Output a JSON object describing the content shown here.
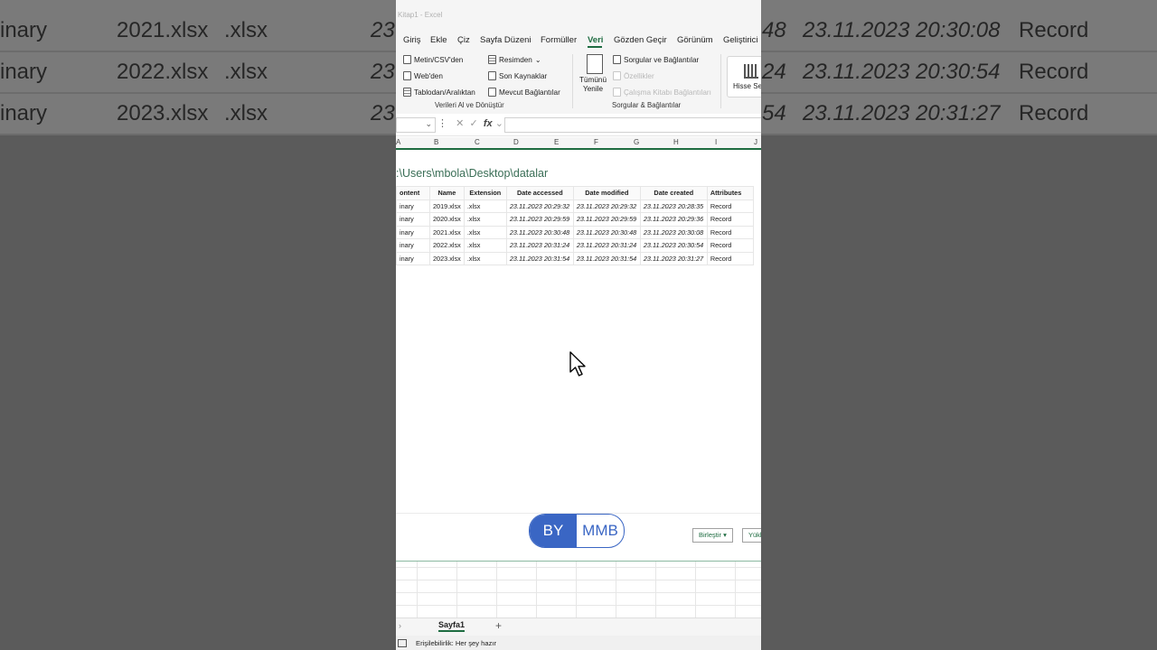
{
  "background": {
    "rows": [
      {
        "content": "inary",
        "name": "2021.xlsx",
        "ext": ".xlsx",
        "col_d": "23",
        "col_g_tail": "48",
        "date_created": "23.11.2023 20:30:08",
        "attr": "Record"
      },
      {
        "content": "inary",
        "name": "2022.xlsx",
        "ext": ".xlsx",
        "col_d": "23",
        "col_g_tail": "24",
        "date_created": "23.11.2023 20:30:54",
        "attr": "Record"
      },
      {
        "content": "inary",
        "name": "2023.xlsx",
        "ext": ".xlsx",
        "col_d": "23",
        "col_g_tail": "54",
        "date_created": "23.11.2023 20:31:27",
        "attr": "Record"
      }
    ]
  },
  "titlebar": {
    "text": "Kitap1  -  Excel"
  },
  "menu": {
    "items": [
      "Giriş",
      "Ekle",
      "Çiz",
      "Sayfa Düzeni",
      "Formüller",
      "Veri",
      "Gözden Geçir",
      "Görünüm",
      "Geliştirici"
    ],
    "active": "Veri"
  },
  "ribbon": {
    "get_data": {
      "from_csv": "Metin/CSV'den",
      "from_web": "Web'den",
      "from_table": "Tablodan/Aralıktan",
      "from_picture": "Resimden",
      "recent_sources": "Son Kaynaklar",
      "existing_connections": "Mevcut Bağlantılar",
      "group_label": "Verileri Al ve Dönüştür"
    },
    "queries": {
      "refresh_all_line1": "Tümünü",
      "refresh_all_line2": "Yenile",
      "queries_connections": "Sorgular ve Bağlantılar",
      "properties": "Özellikler",
      "workbook_links": "Çalışma Kitabı Bağlantıları",
      "group_label": "Sorgular & Bağlantılar"
    },
    "stocks": {
      "label": "Hisse Senedi"
    }
  },
  "formula_bar": {
    "fx": "fx",
    "value": ""
  },
  "columns": [
    "A",
    "B",
    "C",
    "D",
    "E",
    "F",
    "G",
    "H",
    "I",
    "J"
  ],
  "path": ":\\Users\\mbola\\Desktop\\datalar",
  "table": {
    "headers": [
      "ontent",
      "Name",
      "Extension",
      "Date accessed",
      "Date modified",
      "Date created",
      "Attributes"
    ],
    "rows": [
      [
        "inary",
        "2019.xlsx",
        ".xlsx",
        "23.11.2023 20:29:32",
        "23.11.2023 20:29:32",
        "23.11.2023 20:28:35",
        "Record"
      ],
      [
        "inary",
        "2020.xlsx",
        ".xlsx",
        "23.11.2023 20:29:59",
        "23.11.2023 20:29:59",
        "23.11.2023 20:29:36",
        "Record"
      ],
      [
        "inary",
        "2021.xlsx",
        ".xlsx",
        "23.11.2023 20:30:48",
        "23.11.2023 20:30:48",
        "23.11.2023 20:30:08",
        "Record"
      ],
      [
        "inary",
        "2022.xlsx",
        ".xlsx",
        "23.11.2023 20:31:24",
        "23.11.2023 20:31:24",
        "23.11.2023 20:30:54",
        "Record"
      ],
      [
        "inary",
        "2023.xlsx",
        ".xlsx",
        "23.11.2023 20:31:54",
        "23.11.2023 20:31:54",
        "23.11.2023 20:31:27",
        "Record"
      ]
    ]
  },
  "query_bar": {
    "combine": "Birleştir",
    "load": "Yükle"
  },
  "watermark": {
    "left": "BY",
    "right": "MMB"
  },
  "sheets": {
    "active": "Sayfa1",
    "add": "+"
  },
  "status": {
    "accessibility": "Erişilebilirlik: Her şey hazır"
  },
  "colors": {
    "excel_green": "#1e6c41",
    "pill_blue": "#3a66c4"
  }
}
